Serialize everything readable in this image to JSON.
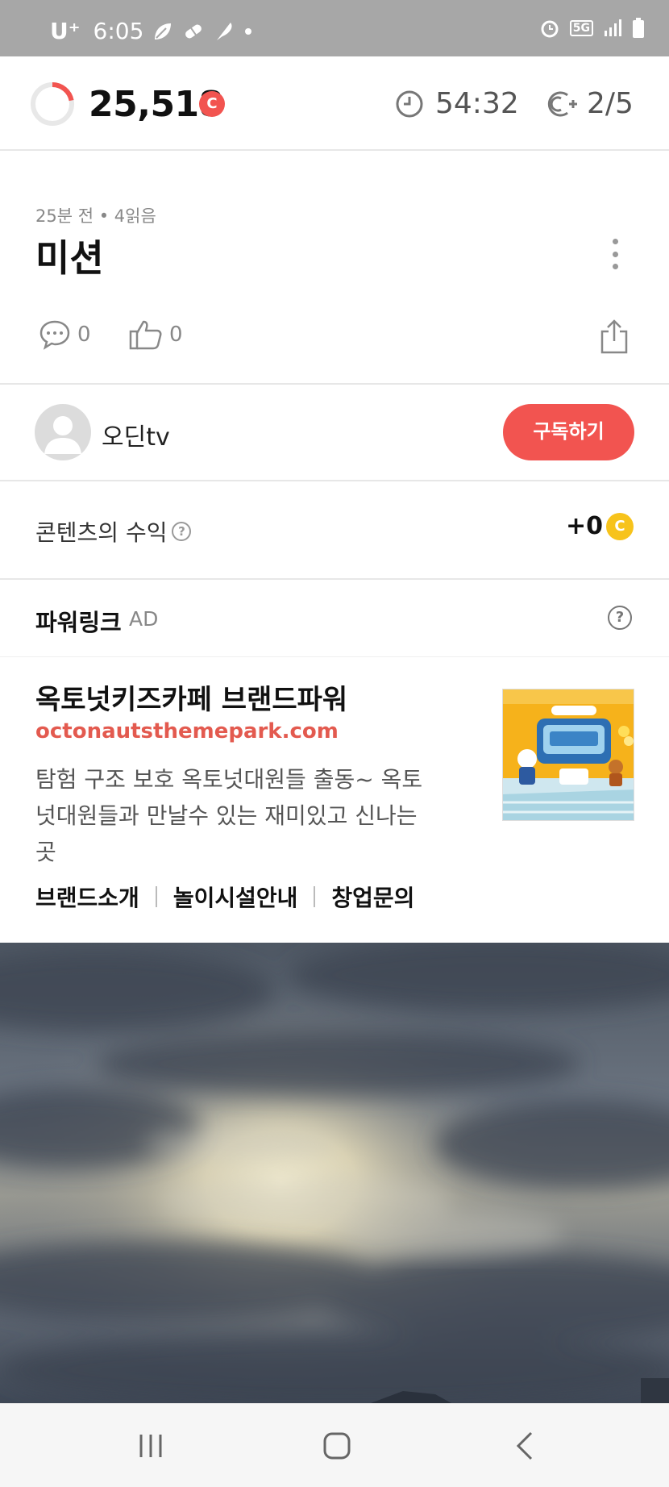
{
  "status_bar": {
    "carrier": "U⁺",
    "time": "6:05",
    "network": "5G",
    "left_icons": [
      "leaf-icon",
      "pill-icon",
      "feather-icon",
      "dot-icon"
    ],
    "right_icons": [
      "alarm-icon",
      "5g-icon",
      "signal-icon",
      "battery-icon"
    ]
  },
  "header": {
    "points": "25,518",
    "points_coin": "C",
    "timer": "54:32",
    "counter": "2/5",
    "progress_fraction": 0.22,
    "accent_color": "#f25450"
  },
  "article": {
    "meta": "25분 전 • 4읽음",
    "title": "미션",
    "comments": "0",
    "likes": "0"
  },
  "author": {
    "name": "오딘tv",
    "subscribe_label": "구독하기"
  },
  "revenue": {
    "label": "콘텐츠의 수익",
    "help": "?",
    "value": "+0",
    "coin": "C"
  },
  "ad": {
    "section_title": "파워링크",
    "tag": "AD",
    "help": "?",
    "brand": "옥토넛키즈카페 브랜드파워",
    "url": "octonautsthemepark.com",
    "description": "탐험 구조 보호 옥토넛대원들 출동~ 옥토넛대원들과 만날수 있는 재미있고 신나는곳",
    "links": [
      "브랜드소개",
      "놀이시설안내",
      "창업문의"
    ]
  },
  "nav": {
    "icons": [
      "recent-apps-icon",
      "home-icon",
      "back-icon"
    ]
  }
}
